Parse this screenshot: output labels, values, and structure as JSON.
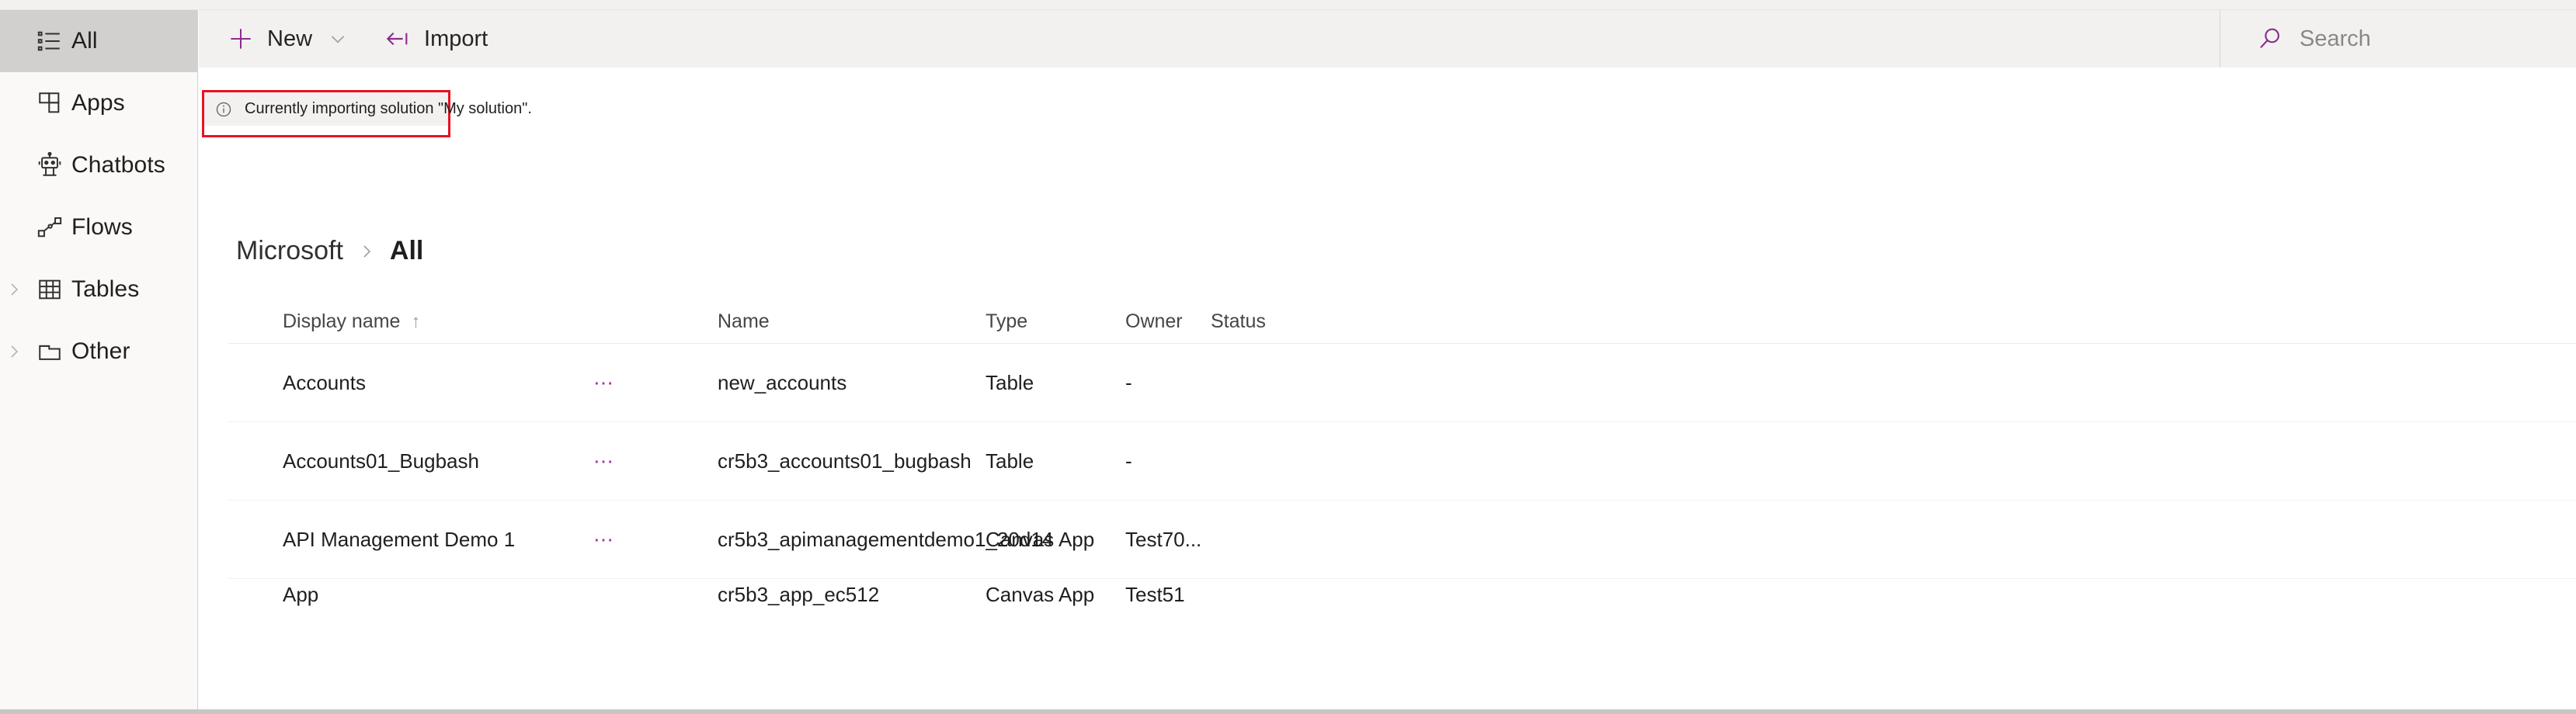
{
  "theme": {
    "accent_purple": "#8c2c8c",
    "tab_accent": "#6b6fb5",
    "annotation_red": "#e81123",
    "ellipsis_purple": "#a4309e",
    "sidebar_bg": "#faf9f8",
    "selected_bg": "#d2d0ce",
    "command_bar_bg": "#f2f1f0"
  },
  "sidebar": {
    "items": [
      {
        "label": "All",
        "icon": "list-icon",
        "selected": true,
        "expandable": false
      },
      {
        "label": "Apps",
        "icon": "apps-grid-icon",
        "selected": false,
        "expandable": false
      },
      {
        "label": "Chatbots",
        "icon": "robot-icon",
        "selected": false,
        "expandable": false
      },
      {
        "label": "Flows",
        "icon": "flow-nodes-icon",
        "selected": false,
        "expandable": false
      },
      {
        "label": "Tables",
        "icon": "table-grid-icon",
        "selected": false,
        "expandable": true
      },
      {
        "label": "Other",
        "icon": "folder-icon",
        "selected": false,
        "expandable": true
      }
    ]
  },
  "command_bar": {
    "new_label": "New",
    "new_icon": "plus-icon",
    "new_caret_icon": "chevron-down-icon",
    "import_label": "Import",
    "import_icon": "import-arrow-icon"
  },
  "search": {
    "icon": "search-icon",
    "placeholder": "Search",
    "value": ""
  },
  "banner": {
    "icon": "info-circle-icon",
    "message": "Currently importing solution \"My solution\"."
  },
  "breadcrumb": {
    "items": [
      "Microsoft",
      "All"
    ],
    "separator_icon": "chevron-right-icon"
  },
  "table": {
    "columns": [
      {
        "label": "Display name",
        "sort": "asc",
        "sort_icon": "arrow-up-icon"
      },
      {
        "label": "",
        "sort": ""
      },
      {
        "label": "Name",
        "sort": ""
      },
      {
        "label": "Type",
        "sort": ""
      },
      {
        "label": "Owner",
        "sort": ""
      },
      {
        "label": "Status",
        "sort": ""
      }
    ],
    "row_menu_icon": "ellipsis-icon",
    "rows": [
      {
        "display_name": "Accounts",
        "name": "new_accounts",
        "type": "Table",
        "owner": "-",
        "status": ""
      },
      {
        "display_name": "Accounts01_Bugbash",
        "name": "cr5b3_accounts01_bugbash",
        "type": "Table",
        "owner": "-",
        "status": ""
      },
      {
        "display_name": "API Management Demo 1",
        "name": "cr5b3_apimanagementdemo1_20d14",
        "type": "Canvas App",
        "owner": "Test70...",
        "status": ""
      },
      {
        "display_name": "App",
        "name": "cr5b3_app_ec512",
        "type": "Canvas App",
        "owner": "Test51",
        "status": ""
      }
    ]
  }
}
